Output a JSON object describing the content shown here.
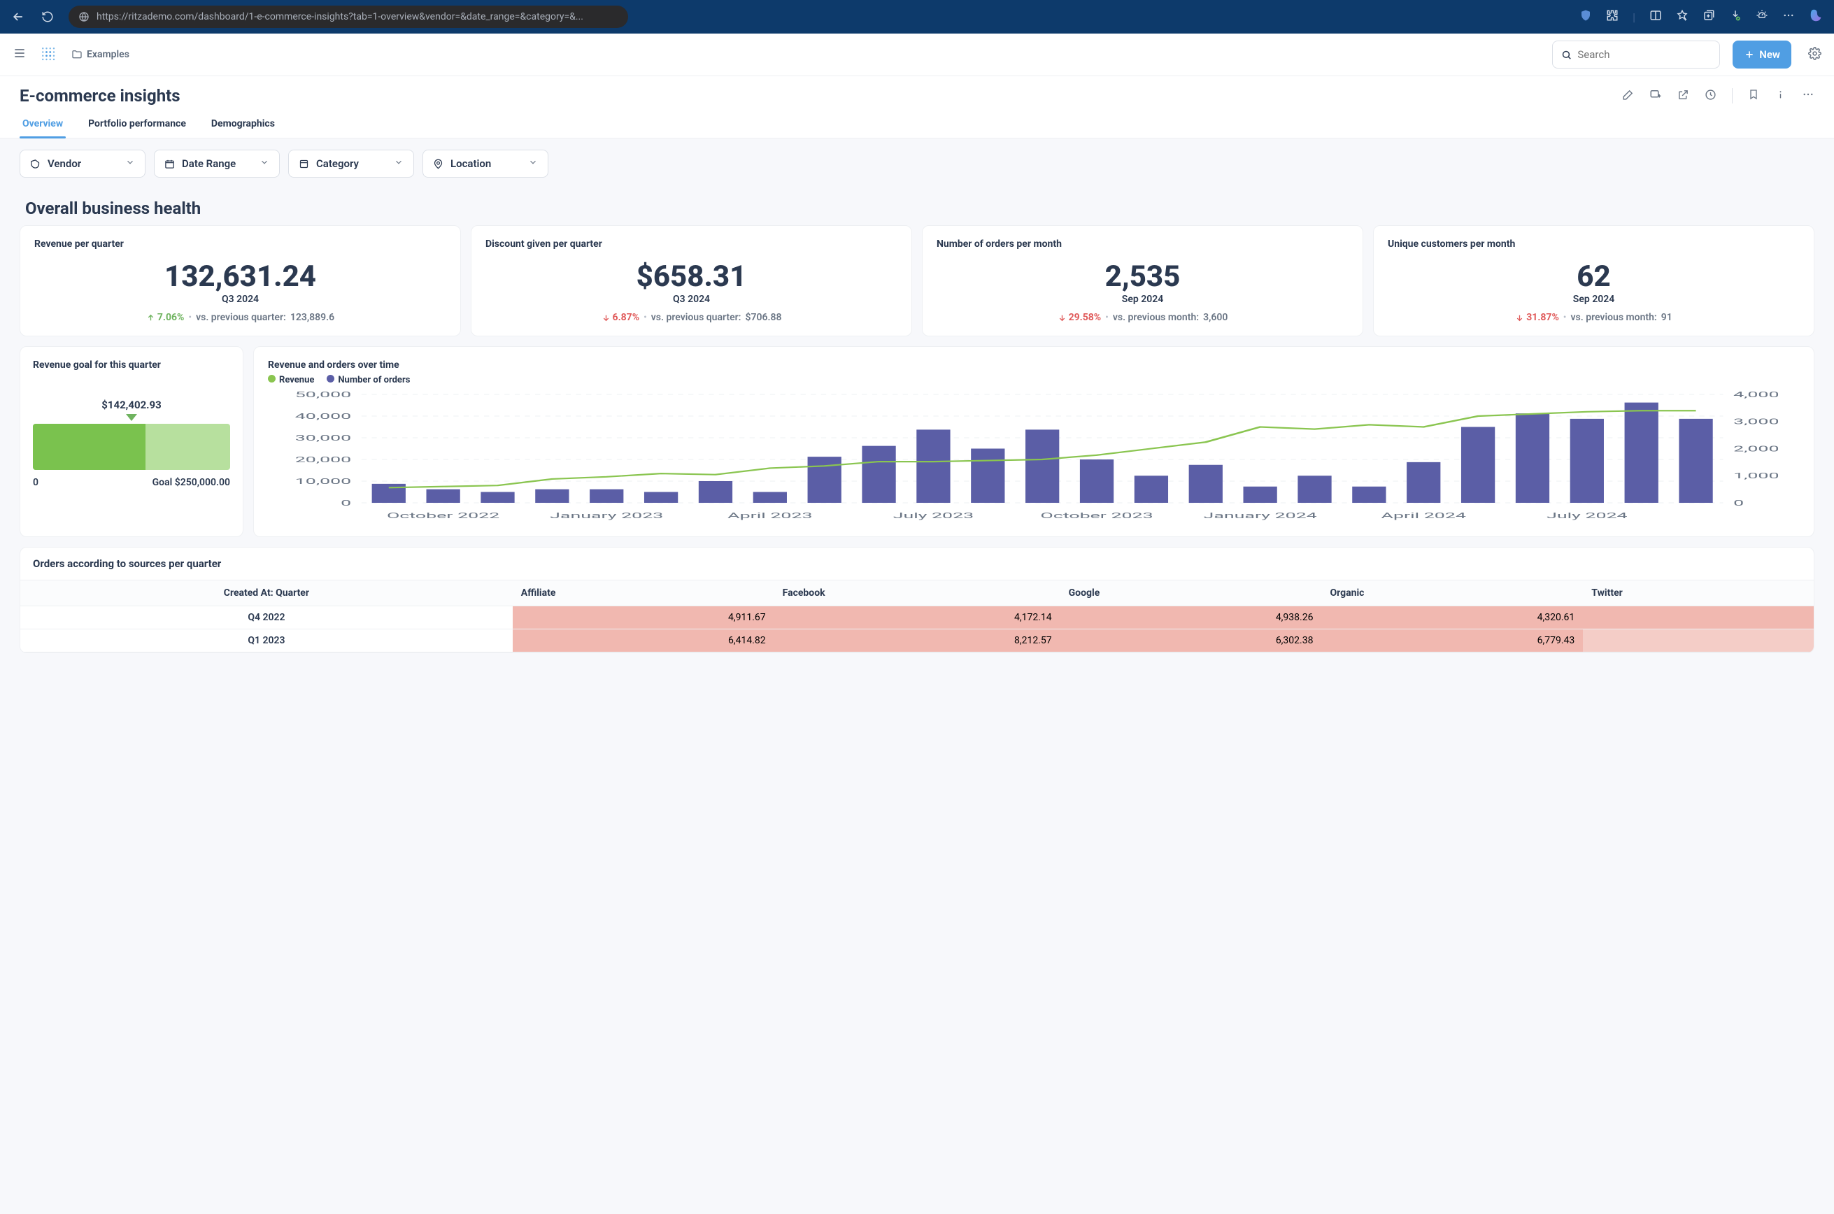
{
  "browser": {
    "url": "https://ritzademo.com/dashboard/1-e-commerce-insights?tab=1-overview&vendor=&date_range=&category=&..."
  },
  "header": {
    "examples_label": "Examples",
    "search_placeholder": "Search",
    "new_label": "New"
  },
  "page": {
    "title": "E-commerce insights"
  },
  "tabs": {
    "overview": "Overview",
    "portfolio": "Portfolio performance",
    "demographics": "Demographics"
  },
  "filters": {
    "vendor": "Vendor",
    "date_range": "Date Range",
    "category": "Category",
    "location": "Location"
  },
  "section": {
    "health_title": "Overall business health"
  },
  "metrics": [
    {
      "title": "Revenue per quarter",
      "value": "132,631.24",
      "period": "Q3 2024",
      "dir": "up",
      "delta": "7.06%",
      "comp_label": "vs. previous quarter:",
      "comp_val": "123,889.6"
    },
    {
      "title": "Discount given per quarter",
      "value": "$658.31",
      "period": "Q3 2024",
      "dir": "down",
      "delta": "6.87%",
      "comp_label": "vs. previous quarter:",
      "comp_val": "$706.88"
    },
    {
      "title": "Number of orders per month",
      "value": "2,535",
      "period": "Sep 2024",
      "dir": "down",
      "delta": "29.58%",
      "comp_label": "vs. previous month:",
      "comp_val": "3,600"
    },
    {
      "title": "Unique customers per month",
      "value": "62",
      "period": "Sep 2024",
      "dir": "down",
      "delta": "31.87%",
      "comp_label": "vs. previous month:",
      "comp_val": "91"
    }
  ],
  "goal": {
    "title": "Revenue goal for this quarter",
    "marker": "$142,402.93",
    "axis_start": "0",
    "axis_end": "Goal $250,000.00",
    "fill_pct": 57
  },
  "chart": {
    "title": "Revenue and orders over time",
    "legend_revenue": "Revenue",
    "legend_orders": "Number of orders",
    "y_ticks": [
      "50,000",
      "40,000",
      "30,000",
      "20,000",
      "10,000",
      "0"
    ],
    "y2_ticks": [
      "4,000",
      "3,000",
      "2,000",
      "1,000",
      "0"
    ],
    "x_labels": [
      "October 2022",
      "January 2023",
      "April 2023",
      "July 2023",
      "October 2023",
      "January 2024",
      "April 2024",
      "July 2024"
    ]
  },
  "chart_data": {
    "type": "bar",
    "title": "Revenue and orders over time",
    "xlabel": "",
    "ylabel": "Revenue",
    "y2label": "Number of orders",
    "ylim": [
      0,
      50000
    ],
    "y2lim": [
      0,
      4000
    ],
    "categories": [
      "Sep 2022",
      "Oct 2022",
      "Nov 2022",
      "Dec 2022",
      "Jan 2023",
      "Feb 2023",
      "Mar 2023",
      "Apr 2023",
      "May 2023",
      "Jun 2023",
      "Jul 2023",
      "Aug 2023",
      "Sep 2023",
      "Oct 2023",
      "Nov 2023",
      "Dec 2023",
      "Jan 2024",
      "Feb 2024",
      "Mar 2024",
      "Apr 2024",
      "May 2024",
      "Jun 2024",
      "Jul 2024",
      "Aug 2024",
      "Sep 2024"
    ],
    "series": [
      {
        "name": "Number of orders",
        "axis": "y2",
        "type": "bar",
        "values": [
          700,
          500,
          400,
          500,
          500,
          400,
          800,
          400,
          1700,
          2100,
          2700,
          2000,
          2700,
          1600,
          1000,
          1400,
          600,
          1000,
          600,
          1500,
          2800,
          3300,
          3100,
          3700,
          3100
        ]
      },
      {
        "name": "Revenue",
        "axis": "y",
        "type": "line",
        "values": [
          7000,
          7500,
          8000,
          11000,
          12000,
          13500,
          13000,
          16000,
          17000,
          19000,
          19000,
          19500,
          20000,
          22000,
          25000,
          28000,
          35000,
          34000,
          36000,
          35000,
          40000,
          41000,
          42000,
          42500,
          42500
        ]
      }
    ]
  },
  "table": {
    "title": "Orders according to sources per quarter",
    "col0": "Created At: Quarter",
    "cols": [
      "Affiliate",
      "Facebook",
      "Google",
      "Organic",
      "Twitter"
    ],
    "rows": [
      {
        "q": "Q4 2022",
        "v": [
          "4,911.67",
          "4,172.14",
          "4,938.26",
          "4,320.61",
          ""
        ]
      },
      {
        "q": "Q1 2023",
        "v": [
          "6,414.82",
          "8,212.57",
          "6,302.38",
          "6,779.43",
          ""
        ]
      }
    ]
  }
}
